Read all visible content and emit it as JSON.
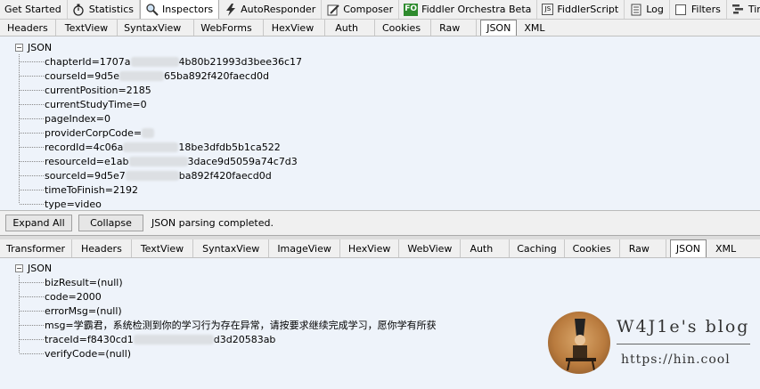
{
  "top_tabs": [
    {
      "label": "Get Started",
      "icon": "none"
    },
    {
      "label": "Statistics",
      "icon": "stopwatch-icon"
    },
    {
      "label": "Inspectors",
      "icon": "magnifier-icon"
    },
    {
      "label": "AutoResponder",
      "icon": "lightning-icon"
    },
    {
      "label": "Composer",
      "icon": "pencil-icon"
    },
    {
      "label": "Fiddler Orchestra Beta",
      "icon": "fo-icon",
      "icon_text": "FO"
    },
    {
      "label": "FiddlerScript",
      "icon": "js-icon",
      "icon_text": "JS"
    },
    {
      "label": "Log",
      "icon": "log-icon"
    },
    {
      "label": "Filters",
      "icon": "checkbox-icon"
    },
    {
      "label": "Timeline",
      "icon": "timeline-icon"
    }
  ],
  "request": {
    "tabs": [
      "Headers",
      "TextView",
      "SyntaxView",
      "WebForms",
      "HexView",
      "Auth",
      "Cookies",
      "Raw",
      "JSON",
      "XML"
    ],
    "active_tab": "JSON",
    "root": "JSON",
    "nodes": [
      {
        "pre": "chapterId=1707a",
        "post": "4b80b21993d3bee36c17"
      },
      {
        "pre": "courseId=9d5e",
        "post": "65ba892f420faecd0d"
      },
      {
        "pre": "currentPosition=2185",
        "post": ""
      },
      {
        "pre": "currentStudyTime=0",
        "post": ""
      },
      {
        "pre": "pageIndex=0",
        "post": ""
      },
      {
        "pre": "providerCorpCode=",
        "post": ""
      },
      {
        "pre": "recordId=4c06a",
        "post": "18be3dfdb5b1ca522"
      },
      {
        "pre": "resourceId=e1ab",
        "post": "3dace9d5059a74c7d3"
      },
      {
        "pre": "sourceId=9d5e7",
        "post": "ba892f420faecd0d"
      },
      {
        "pre": "timeToFinish=2192",
        "post": ""
      },
      {
        "pre": "type=video",
        "post": ""
      }
    ],
    "expand_all": "Expand All",
    "collapse": "Collapse",
    "status": "JSON parsing completed."
  },
  "response": {
    "tabs": [
      "Transformer",
      "Headers",
      "TextView",
      "SyntaxView",
      "ImageView",
      "HexView",
      "WebView",
      "Auth",
      "Caching",
      "Cookies",
      "Raw",
      "JSON",
      "XML"
    ],
    "active_tab": "JSON",
    "root": "JSON",
    "nodes": [
      {
        "pre": "bizResult=(null)",
        "post": ""
      },
      {
        "pre": "code=2000",
        "post": ""
      },
      {
        "pre": "errorMsg=(null)",
        "post": ""
      },
      {
        "pre": "msg=学霸君，系统检测到你的学习行为存在异常，请按要求继续完成学习，愿你学有所获",
        "post": ""
      },
      {
        "pre": "traceId=f8430cd1",
        "post": "d3d20583ab"
      },
      {
        "pre": "verifyCode=(null)",
        "post": ""
      }
    ]
  },
  "watermark": {
    "title": "W4J1e's blog",
    "url": "https://hin.cool"
  }
}
